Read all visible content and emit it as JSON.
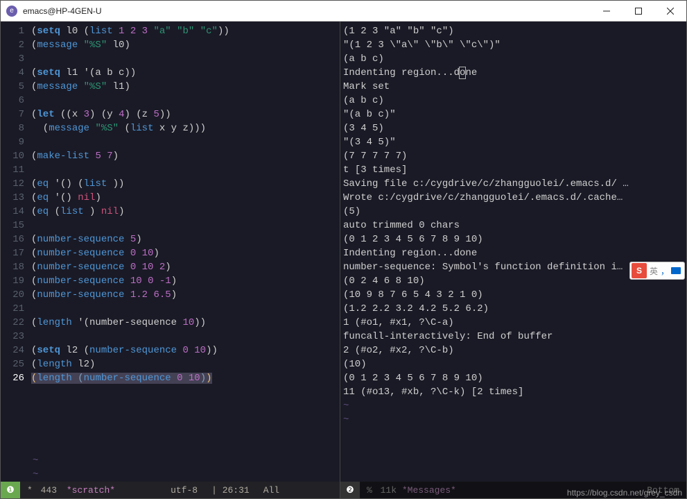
{
  "window": {
    "title": "emacs@HP-4GEN-U"
  },
  "left_buffer": {
    "lines": [
      [
        {
          "t": "(",
          "c": "p"
        },
        {
          "t": "setq",
          "c": "kw"
        },
        {
          "t": " l0 ",
          "c": "p"
        },
        {
          "t": "(",
          "c": "p"
        },
        {
          "t": "list",
          "c": "fn"
        },
        {
          "t": " ",
          "c": "p"
        },
        {
          "t": "1",
          "c": "num"
        },
        {
          "t": " ",
          "c": "p"
        },
        {
          "t": "2",
          "c": "num"
        },
        {
          "t": " ",
          "c": "p"
        },
        {
          "t": "3",
          "c": "num"
        },
        {
          "t": " ",
          "c": "p"
        },
        {
          "t": "\"a\"",
          "c": "str"
        },
        {
          "t": " ",
          "c": "p"
        },
        {
          "t": "\"b\"",
          "c": "str"
        },
        {
          "t": " ",
          "c": "p"
        },
        {
          "t": "\"c\"",
          "c": "str"
        },
        {
          "t": "))",
          "c": "p"
        }
      ],
      [
        {
          "t": "(",
          "c": "p"
        },
        {
          "t": "message",
          "c": "fn"
        },
        {
          "t": " ",
          "c": "p"
        },
        {
          "t": "\"%S\"",
          "c": "str"
        },
        {
          "t": " l0)",
          "c": "p"
        }
      ],
      [],
      [
        {
          "t": "(",
          "c": "p"
        },
        {
          "t": "setq",
          "c": "kw"
        },
        {
          "t": " l1 '(a b c))",
          "c": "p"
        }
      ],
      [
        {
          "t": "(",
          "c": "p"
        },
        {
          "t": "message",
          "c": "fn"
        },
        {
          "t": " ",
          "c": "p"
        },
        {
          "t": "\"%S\"",
          "c": "str"
        },
        {
          "t": " l1)",
          "c": "p"
        }
      ],
      [],
      [
        {
          "t": "(",
          "c": "p"
        },
        {
          "t": "let",
          "c": "kw"
        },
        {
          "t": " ((x ",
          "c": "p"
        },
        {
          "t": "3",
          "c": "num"
        },
        {
          "t": ") (y ",
          "c": "p"
        },
        {
          "t": "4",
          "c": "num"
        },
        {
          "t": ") (z ",
          "c": "p"
        },
        {
          "t": "5",
          "c": "num"
        },
        {
          "t": "))",
          "c": "p"
        }
      ],
      [
        {
          "t": "  (",
          "c": "p"
        },
        {
          "t": "message",
          "c": "fn"
        },
        {
          "t": " ",
          "c": "p"
        },
        {
          "t": "\"%S\"",
          "c": "str"
        },
        {
          "t": " (",
          "c": "p"
        },
        {
          "t": "list",
          "c": "fn"
        },
        {
          "t": " x y z)))",
          "c": "p"
        }
      ],
      [],
      [
        {
          "t": "(",
          "c": "p"
        },
        {
          "t": "make-list",
          "c": "fn"
        },
        {
          "t": " ",
          "c": "p"
        },
        {
          "t": "5",
          "c": "num"
        },
        {
          "t": " ",
          "c": "p"
        },
        {
          "t": "7",
          "c": "num"
        },
        {
          "t": ")",
          "c": "p"
        }
      ],
      [],
      [
        {
          "t": "(",
          "c": "p"
        },
        {
          "t": "eq",
          "c": "fn"
        },
        {
          "t": " '() (",
          "c": "p"
        },
        {
          "t": "list",
          "c": "fn"
        },
        {
          "t": " ))",
          "c": "p"
        }
      ],
      [
        {
          "t": "(",
          "c": "p"
        },
        {
          "t": "eq",
          "c": "fn"
        },
        {
          "t": " '() ",
          "c": "p"
        },
        {
          "t": "nil",
          "c": "sym"
        },
        {
          "t": ")",
          "c": "p"
        }
      ],
      [
        {
          "t": "(",
          "c": "p"
        },
        {
          "t": "eq",
          "c": "fn"
        },
        {
          "t": " (",
          "c": "p"
        },
        {
          "t": "list",
          "c": "fn"
        },
        {
          "t": " ) ",
          "c": "p"
        },
        {
          "t": "nil",
          "c": "sym"
        },
        {
          "t": ")",
          "c": "p"
        }
      ],
      [],
      [
        {
          "t": "(",
          "c": "p"
        },
        {
          "t": "number-sequence",
          "c": "fn"
        },
        {
          "t": " ",
          "c": "p"
        },
        {
          "t": "5",
          "c": "num"
        },
        {
          "t": ")",
          "c": "p"
        }
      ],
      [
        {
          "t": "(",
          "c": "p"
        },
        {
          "t": "number-sequence",
          "c": "fn"
        },
        {
          "t": " ",
          "c": "p"
        },
        {
          "t": "0",
          "c": "num"
        },
        {
          "t": " ",
          "c": "p"
        },
        {
          "t": "10",
          "c": "num"
        },
        {
          "t": ")",
          "c": "p"
        }
      ],
      [
        {
          "t": "(",
          "c": "p"
        },
        {
          "t": "number-sequence",
          "c": "fn"
        },
        {
          "t": " ",
          "c": "p"
        },
        {
          "t": "0",
          "c": "num"
        },
        {
          "t": " ",
          "c": "p"
        },
        {
          "t": "10",
          "c": "num"
        },
        {
          "t": " ",
          "c": "p"
        },
        {
          "t": "2",
          "c": "num"
        },
        {
          "t": ")",
          "c": "p"
        }
      ],
      [
        {
          "t": "(",
          "c": "p"
        },
        {
          "t": "number-sequence",
          "c": "fn"
        },
        {
          "t": " ",
          "c": "p"
        },
        {
          "t": "10",
          "c": "num"
        },
        {
          "t": " ",
          "c": "p"
        },
        {
          "t": "0",
          "c": "num"
        },
        {
          "t": " ",
          "c": "p"
        },
        {
          "t": "-1",
          "c": "num"
        },
        {
          "t": ")",
          "c": "p"
        }
      ],
      [
        {
          "t": "(",
          "c": "p"
        },
        {
          "t": "number-sequence",
          "c": "fn"
        },
        {
          "t": " ",
          "c": "p"
        },
        {
          "t": "1.2",
          "c": "num"
        },
        {
          "t": " ",
          "c": "p"
        },
        {
          "t": "6.5",
          "c": "num"
        },
        {
          "t": ")",
          "c": "p"
        }
      ],
      [],
      [
        {
          "t": "(",
          "c": "p"
        },
        {
          "t": "length",
          "c": "fn"
        },
        {
          "t": " '(number-sequence ",
          "c": "p"
        },
        {
          "t": "10",
          "c": "num"
        },
        {
          "t": "))",
          "c": "p"
        }
      ],
      [],
      [
        {
          "t": "(",
          "c": "p"
        },
        {
          "t": "setq",
          "c": "kw"
        },
        {
          "t": " l2 (",
          "c": "p"
        },
        {
          "t": "number-sequence",
          "c": "fn"
        },
        {
          "t": " ",
          "c": "p"
        },
        {
          "t": "0",
          "c": "num"
        },
        {
          "t": " ",
          "c": "p"
        },
        {
          "t": "10",
          "c": "num"
        },
        {
          "t": "))",
          "c": "p"
        }
      ],
      [
        {
          "t": "(",
          "c": "p"
        },
        {
          "t": "length",
          "c": "fn"
        },
        {
          "t": " l2)",
          "c": "p"
        }
      ],
      [
        {
          "t": "(",
          "c": "match0 hlp"
        },
        {
          "t": "length",
          "c": "fn hlp"
        },
        {
          "t": " ",
          "c": "p hlp"
        },
        {
          "t": "(",
          "c": "match1 hlp"
        },
        {
          "t": "number-sequence",
          "c": "fn hlp"
        },
        {
          "t": " ",
          "c": "p hlp"
        },
        {
          "t": "0",
          "c": "num hlp"
        },
        {
          "t": " ",
          "c": "p hlp"
        },
        {
          "t": "10",
          "c": "num hlp"
        },
        {
          "t": ")",
          "c": "match1 hlp"
        },
        {
          "t": ")",
          "c": "match0 hlp"
        }
      ]
    ],
    "current_line": 26,
    "tildes": 2
  },
  "right_buffer": {
    "lines": [
      "(1 2 3 \"a\" \"b\" \"c\")",
      "\"(1 2 3 \\\"a\\\" \\\"b\\\" \\\"c\\\")\"",
      "(a b c)",
      "Indenting region...done",
      "Mark set",
      "(a b c)",
      "\"(a b c)\"",
      "(3 4 5)",
      "\"(3 4 5)\"",
      "(7 7 7 7 7)",
      "t [3 times]",
      "Saving file c:/cygdrive/c/zhangguolei/.emacs.d/ …",
      "Wrote c:/cygdrive/c/zhangguolei/.emacs.d/.cache…",
      "(5)",
      "auto trimmed 0 chars",
      "(0 1 2 3 4 5 6 7 8 9 10)",
      "Indenting region...done",
      "number-sequence: Symbol's function definition i…",
      "(0 2 4 6 8 10)",
      "(10 9 8 7 6 5 4 3 2 1 0)",
      "(1.2 2.2 3.2 4.2 5.2 6.2)",
      "1 (#o1, #x1, ?\\C-a)",
      "funcall-interactively: End of buffer",
      "2 (#o2, #x2, ?\\C-b)",
      "(10)",
      "(0 1 2 3 4 5 6 7 8 9 10)",
      "11 (#o13, #xb, ?\\C-k) [2 times]"
    ],
    "cursor_line": 3,
    "cursor_col": 20,
    "tildes": 2
  },
  "modeline_left": {
    "badge": "❶",
    "modified": "*",
    "size": "443",
    "buffer": "*scratch*",
    "encoding": "utf-8",
    "position": "26:31",
    "scroll": "All"
  },
  "modeline_right": {
    "badge": "❷",
    "modified": "%",
    "size": "11k",
    "buffer": "*Messages*",
    "scroll": "Bottom"
  },
  "ime": {
    "s": "S",
    "lang": "英"
  },
  "watermark": "https://blog.csdn.net/grey_csdn"
}
